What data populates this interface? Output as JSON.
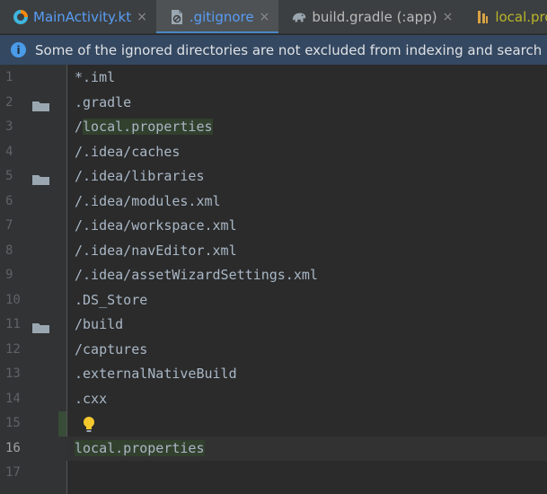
{
  "tabs": [
    {
      "label": "MainActivity.kt",
      "color": "#589df6",
      "icon": "kotlin-file-icon",
      "close": "×"
    },
    {
      "label": ".gitignore",
      "color": "#589df6",
      "icon": "ignore-file-icon",
      "close": "×",
      "active": true
    },
    {
      "label": "build.gradle (:app)",
      "color": "#bbbbbb",
      "icon": "gradle-elephant-icon",
      "close": "×"
    },
    {
      "label": "local.properties",
      "color": "#bbb529",
      "icon": "properties-file-icon"
    }
  ],
  "banner": {
    "icon": "info-icon",
    "icon_glyph": "i",
    "text": "Some of the ignored directories are not excluded from indexing and search"
  },
  "editor": {
    "lines": [
      {
        "num": "1",
        "text": "*.iml"
      },
      {
        "num": "2",
        "text": ".gradle",
        "folder_icon": true
      },
      {
        "num": "3",
        "prefix": "/",
        "highlighted": "local.properties"
      },
      {
        "num": "4",
        "text": "/.idea/caches"
      },
      {
        "num": "5",
        "text": "/.idea/libraries",
        "folder_icon": true
      },
      {
        "num": "6",
        "text": "/.idea/modules.xml"
      },
      {
        "num": "7",
        "text": "/.idea/workspace.xml"
      },
      {
        "num": "8",
        "text": "/.idea/navEditor.xml"
      },
      {
        "num": "9",
        "text": "/.idea/assetWizardSettings.xml"
      },
      {
        "num": "10",
        "text": ".DS_Store"
      },
      {
        "num": "11",
        "text": "/build",
        "folder_icon": true
      },
      {
        "num": "12",
        "text": "/captures"
      },
      {
        "num": "13",
        "text": ".externalNativeBuild"
      },
      {
        "num": "14",
        "text": ".cxx"
      },
      {
        "num": "15",
        "text": "",
        "intention_bulb": true
      },
      {
        "num": "16",
        "text": "",
        "highlighted": "local.properties",
        "current": true
      },
      {
        "num": "17",
        "text": ""
      }
    ]
  },
  "colors": {
    "code_text": "#a9b7c6",
    "line_number": "#606366",
    "highlight_bg": "#32402e",
    "active_tab_underline": "#4a88c7",
    "banner_bg": "#344861"
  }
}
